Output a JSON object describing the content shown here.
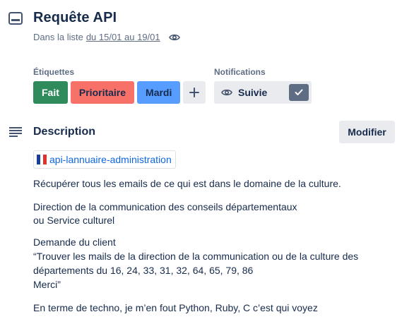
{
  "card": {
    "title": "Requête API",
    "in_list_prefix": "Dans la liste",
    "list_name": "du 15/01 au 19/01"
  },
  "labels": {
    "heading": "Étiquettes",
    "items": [
      {
        "text": "Fait",
        "color": "#2f8a5c"
      },
      {
        "text": "Prioritaire",
        "color": "#f87168"
      },
      {
        "text": "Mardi",
        "color": "#579dff"
      }
    ],
    "add_icon": "plus-icon"
  },
  "notifications": {
    "heading": "Notifications",
    "follow_label": "Suivie",
    "following": true
  },
  "description": {
    "heading": "Description",
    "edit_label": "Modifier",
    "link_text": "api-lannuaire-administration",
    "paragraphs": {
      "p1": "Récupérer tous les emails de ce qui est dans le domaine de la culture.",
      "p2_l1": "Direction de la communication des conseils départementaux",
      "p2_l2": "ou Service culturel",
      "p3_l1": "Demande du client",
      "p3_l2": "“Trouver les mails de la direction de la communication ou de la culture des",
      "p3_l3": "départements du 16, 24, 33, 31, 32, 64, 65, 79, 86",
      "p3_l4": "Merci”",
      "p4": "En terme de techno, je m’en fout Python, Ruby, C c’est qui voyez"
    }
  }
}
